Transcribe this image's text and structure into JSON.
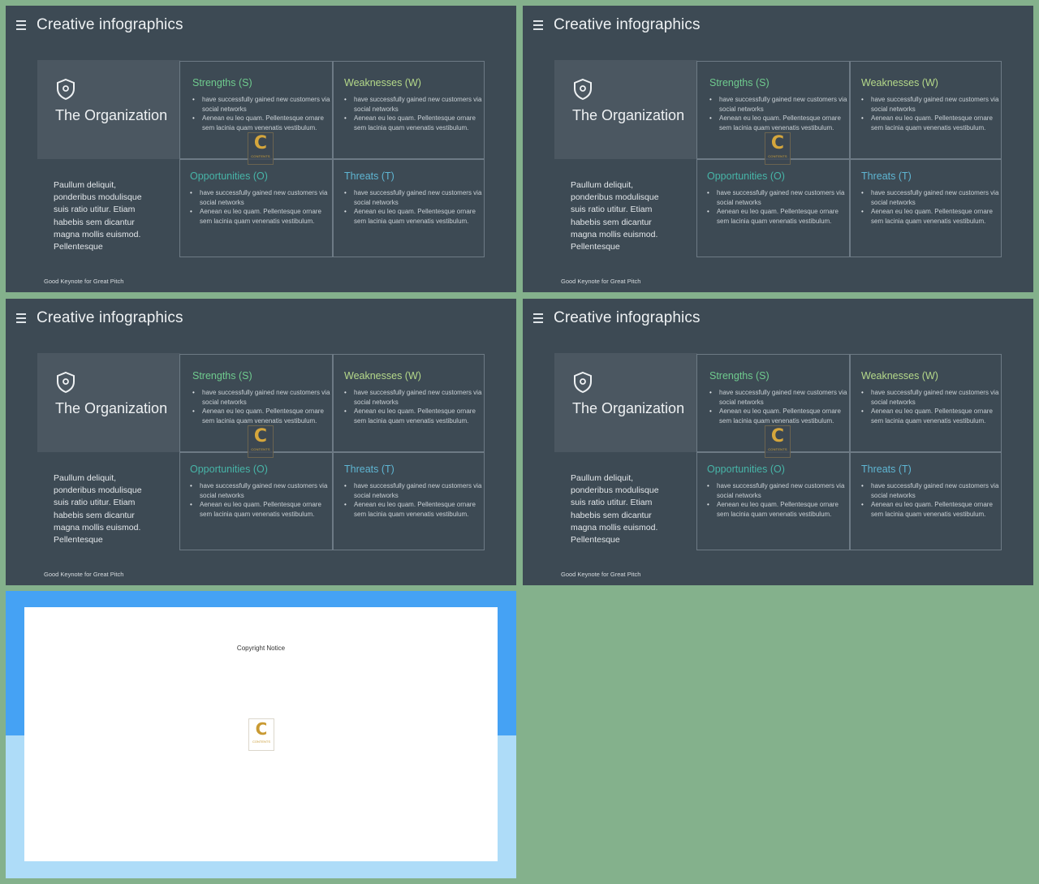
{
  "slides": [
    {
      "title": "Creative infographics",
      "organization": "The Organization",
      "description": "Paullum deliquit, ponderibus modulisque suis ratio utitur. Etiam habebis sem dicantur magna mollis euismod. Pellentesque",
      "footer": "Good Keynote for Great Pitch",
      "swot": {
        "strengths": {
          "heading": "Strengths (S)",
          "bullets": [
            "have successfully gained new customers via social networks",
            "Aenean eu leo quam. Pellentesque ornare sem lacinia quam venenatis vestibulum."
          ]
        },
        "weaknesses": {
          "heading": "Weaknesses (W)",
          "bullets": [
            "have successfully gained new customers via social networks",
            "Aenean eu leo quam. Pellentesque ornare sem lacinia quam venenatis vestibulum."
          ]
        },
        "opportunities": {
          "heading": "Opportunities (O)",
          "bullets": [
            "have successfully gained new customers via social networks",
            "Aenean eu leo quam. Pellentesque ornare sem lacinia quam venenatis vestibulum."
          ]
        },
        "threats": {
          "heading": "Threats (T)",
          "bullets": [
            "have successfully gained new customers via social networks",
            "Aenean eu leo quam. Pellentesque ornare sem lacinia quam venenatis vestibulum."
          ]
        }
      }
    },
    {
      "title": "Creative infographics",
      "organization": "The Organization",
      "description": "Paullum deliquit, ponderibus modulisque suis ratio utitur. Etiam habebis sem dicantur magna mollis euismod. Pellentesque",
      "footer": "Good Keynote for Great Pitch",
      "swot": {
        "strengths": {
          "heading": "Strengths (S)",
          "bullets": [
            "have successfully gained new customers via social networks",
            "Aenean eu leo quam. Pellentesque ornare sem lacinia quam venenatis vestibulum."
          ]
        },
        "weaknesses": {
          "heading": "Weaknesses (W)",
          "bullets": [
            "have successfully gained new customers via social networks",
            "Aenean eu leo quam. Pellentesque ornare sem lacinia quam venenatis vestibulum."
          ]
        },
        "opportunities": {
          "heading": "Opportunities (O)",
          "bullets": [
            "have successfully gained new customers via social networks",
            "Aenean eu leo quam. Pellentesque ornare sem lacinia quam venenatis vestibulum."
          ]
        },
        "threats": {
          "heading": "Threats (T)",
          "bullets": [
            "have successfully gained new customers via social networks",
            "Aenean eu leo quam. Pellentesque ornare sem lacinia quam venenatis vestibulum."
          ]
        }
      }
    },
    {
      "title": "Creative infographics",
      "organization": "The Organization",
      "description": "Paullum deliquit, ponderibus modulisque suis ratio utitur. Etiam habebis sem dicantur magna mollis euismod. Pellentesque",
      "footer": "Good Keynote for Great Pitch",
      "swot": {
        "strengths": {
          "heading": "Strengths (S)",
          "bullets": [
            "have successfully gained new customers via social networks",
            "Aenean eu leo quam. Pellentesque ornare sem lacinia quam venenatis vestibulum."
          ]
        },
        "weaknesses": {
          "heading": "Weaknesses (W)",
          "bullets": [
            "have successfully gained new customers via social networks",
            "Aenean eu leo quam. Pellentesque ornare sem lacinia quam venenatis vestibulum."
          ]
        },
        "opportunities": {
          "heading": "Opportunities (O)",
          "bullets": [
            "have successfully gained new customers via social networks",
            "Aenean eu leo quam. Pellentesque ornare sem lacinia quam venenatis vestibulum."
          ]
        },
        "threats": {
          "heading": "Threats (T)",
          "bullets": [
            "have successfully gained new customers via social networks",
            "Aenean eu leo quam. Pellentesque ornare sem lacinia quam venenatis vestibulum."
          ]
        }
      }
    },
    {
      "title": "Creative infographics",
      "organization": "The Organization",
      "description": "Paullum deliquit, ponderibus modulisque suis ratio utitur. Etiam habebis sem dicantur magna mollis euismod. Pellentesque",
      "footer": "Good Keynote for Great Pitch",
      "swot": {
        "strengths": {
          "heading": "Strengths (S)",
          "bullets": [
            "have successfully gained new customers via social networks",
            "Aenean eu leo quam. Pellentesque ornare sem lacinia quam venenatis vestibulum."
          ]
        },
        "weaknesses": {
          "heading": "Weaknesses (W)",
          "bullets": [
            "have successfully gained new customers via social networks",
            "Aenean eu leo quam. Pellentesque ornare sem lacinia quam venenatis vestibulum."
          ]
        },
        "opportunities": {
          "heading": "Opportunities (O)",
          "bullets": [
            "have successfully gained new customers via social networks",
            "Aenean eu leo quam. Pellentesque ornare sem lacinia quam venenatis vestibulum."
          ]
        },
        "threats": {
          "heading": "Threats (T)",
          "bullets": [
            "have successfully gained new customers via social networks",
            "Aenean eu leo quam. Pellentesque ornare sem lacinia quam venenatis vestibulum."
          ]
        }
      }
    }
  ],
  "watermark": {
    "letter": "C",
    "text": "CONTENTS"
  },
  "notice": {
    "title": "Copyright Notice",
    "logo_letter": "C",
    "logo_text": "CONTENTS"
  },
  "icons": {
    "menu": "hamburger-menu-icon",
    "organization": "shield-icon"
  },
  "colors": {
    "background": "#84b18c",
    "slide": "#3d4a54",
    "strengths": "#6fcb8e",
    "weaknesses": "#b5d98a",
    "opportunities": "#47b5a8",
    "threats": "#5fb6d3",
    "notice_top": "#45a2f4",
    "notice_bottom": "#aedcf8"
  }
}
